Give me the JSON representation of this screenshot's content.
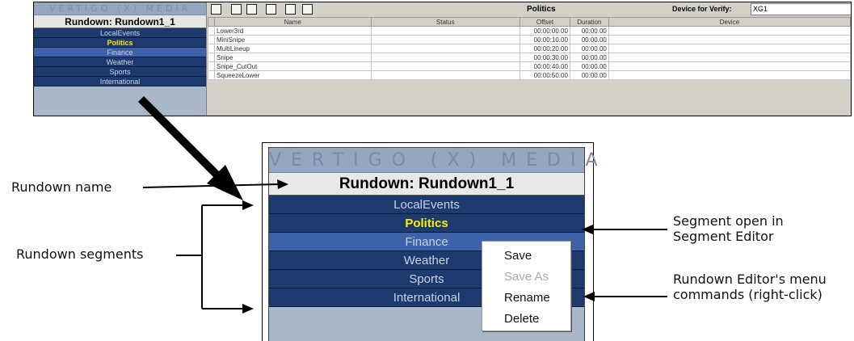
{
  "top_window": {
    "logo": "VERTIGO (X) MEDIA",
    "rundown_title": "Rundown: Rundown1_1",
    "segments": [
      "LocalEvents",
      "Politics",
      "Finance",
      "Weather",
      "Sports",
      "International"
    ],
    "active_segment": "Politics",
    "selected_segment": "Finance",
    "toolbar": {
      "segment_title": "Politics",
      "device_label": "Device for Verify:",
      "device_value": "XG1",
      "icons": [
        "new-icon",
        "save-icon",
        "copy-icon",
        "paste-icon",
        "insert-icon",
        "verify-icon"
      ]
    },
    "grid": {
      "columns": [
        "Name",
        "Status",
        "Offset",
        "Duration",
        "Device"
      ],
      "rows": [
        {
          "name": "Lower3rd",
          "status": "",
          "offset": "00:00:00.00",
          "duration": "00:00.00",
          "device": ""
        },
        {
          "name": "MiniSnipe",
          "status": "",
          "offset": "00:00:10.00",
          "duration": "00:00.00",
          "device": ""
        },
        {
          "name": "MultiLineup",
          "status": "",
          "offset": "00:00:20.00",
          "duration": "00:00.00",
          "device": ""
        },
        {
          "name": "Snipe",
          "status": "",
          "offset": "00:00:30.00",
          "duration": "00:00.00",
          "device": ""
        },
        {
          "name": "Snipe_CutOut",
          "status": "",
          "offset": "00:00:40.00",
          "duration": "00:00.00",
          "device": ""
        },
        {
          "name": "SqueezeLower",
          "status": "",
          "offset": "00:00:50.00",
          "duration": "00:00.00",
          "device": ""
        }
      ]
    }
  },
  "zoom_panel": {
    "logo": "VERTIGO (X) MEDIA",
    "rundown_title": "Rundown: Rundown1_1",
    "segments": [
      "LocalEvents",
      "Politics",
      "Finance",
      "Weather",
      "Sports",
      "International"
    ],
    "active_segment": "Politics",
    "selected_segment": "Finance"
  },
  "context_menu": {
    "items": [
      {
        "label": "Save",
        "enabled": true
      },
      {
        "label": "Save As",
        "enabled": false
      },
      {
        "label": "Rename",
        "enabled": true
      },
      {
        "label": "Delete",
        "enabled": true
      }
    ]
  },
  "callouts": {
    "rundown_name": "Rundown name",
    "rundown_segments": "Rundown segments",
    "segment_open": "Segment open in Segment Editor",
    "menu_commands": "Rundown Editor's menu commands (right-click)"
  },
  "colors": {
    "panel_bg": "#aab7c9",
    "segment_bg": "#1c3a6e",
    "segment_selected_bg": "#3d62a8",
    "segment_text": "#c9d3e8",
    "segment_active_text": "#ffee00"
  }
}
